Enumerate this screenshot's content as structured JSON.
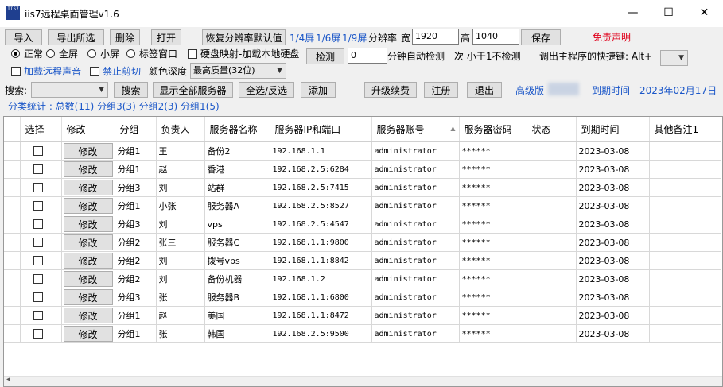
{
  "window": {
    "title": "iis7远程桌面管理v1.6",
    "icon_text": "IIS7",
    "minimize_glyph": "—",
    "maximize_glyph": "☐",
    "close_glyph": "✕"
  },
  "toolbar": {
    "import_label": "导入",
    "export_selected_label": "导出所选",
    "delete_label": "删除",
    "open_label": "打开",
    "restore_resolution_label": "恢复分辨率默认值",
    "screen_quarter": "1/4屏",
    "screen_sixth": "1/6屏",
    "screen_ninth": "1/9屏",
    "resolution_label": "分辨率",
    "width_label": "宽",
    "width_value": "1920",
    "height_label": "高",
    "height_value": "1040",
    "save_label": "保存",
    "disclaimer_label": "免责声明"
  },
  "options": {
    "mode_normal": "正常",
    "mode_fullscreen": "全屏",
    "mode_small": "小屏",
    "mode_tab": "标签窗口",
    "disk_map_label": "硬盘映射-加载本地硬盘",
    "detect_label": "检测",
    "detect_value": "0",
    "detect_suffix": "分钟自动检测一次 小于1不检测",
    "hotkey_label": "调出主程序的快捷键: Alt+",
    "load_sound_label": "加载远程声音",
    "disable_clipboard_label": "禁止剪切",
    "color_depth_label": "颜色深度",
    "color_depth_value": "最高质量(32位)"
  },
  "search": {
    "label": "搜索:",
    "search_button": "搜索",
    "show_all_button": "显示全部服务器",
    "select_all_button": "全选/反选",
    "add_button": "添加",
    "upgrade_button": "升级续费",
    "register_button": "注册",
    "exit_button": "退出",
    "edition_label": "高级版-",
    "expire_label": "到期时间",
    "expire_date": "2023年02月17日"
  },
  "stats": {
    "text": "分类统计 : 总数(11) 分组3(3) 分组2(3) 分组1(5)"
  },
  "table": {
    "headers": [
      "选择",
      "修改",
      "分组",
      "负责人",
      "服务器名称",
      "服务器IP和端口",
      "服务器账号",
      "服务器密码",
      "状态",
      "到期时间",
      "其他备注1"
    ],
    "edit_label": "修改",
    "rows": [
      {
        "group": "分组1",
        "owner": "王",
        "name": "备份2",
        "ip": "192.168.1.1",
        "account": "administrator",
        "password": "******",
        "status": "",
        "expire": "2023-03-08",
        "note": ""
      },
      {
        "group": "分组1",
        "owner": "赵",
        "name": "香港",
        "ip": "192.168.2.5:6284",
        "account": "administrator",
        "password": "******",
        "status": "",
        "expire": "2023-03-08",
        "note": ""
      },
      {
        "group": "分组3",
        "owner": "刘",
        "name": "站群",
        "ip": "192.168.2.5:7415",
        "account": "administrator",
        "password": "******",
        "status": "",
        "expire": "2023-03-08",
        "note": ""
      },
      {
        "group": "分组1",
        "owner": "小张",
        "name": "服务器A",
        "ip": "192.168.2.5:8527",
        "account": "administrator",
        "password": "******",
        "status": "",
        "expire": "2023-03-08",
        "note": ""
      },
      {
        "group": "分组3",
        "owner": "刘",
        "name": "vps",
        "ip": "192.168.2.5:4547",
        "account": "administrator",
        "password": "******",
        "status": "",
        "expire": "2023-03-08",
        "note": ""
      },
      {
        "group": "分组2",
        "owner": "张三",
        "name": "服务器C",
        "ip": "192.168.1.1:9800",
        "account": "administrator",
        "password": "******",
        "status": "",
        "expire": "2023-03-08",
        "note": ""
      },
      {
        "group": "分组2",
        "owner": "刘",
        "name": "拨号vps",
        "ip": "192.168.1.1:8842",
        "account": "administrator",
        "password": "******",
        "status": "",
        "expire": "2023-03-08",
        "note": ""
      },
      {
        "group": "分组2",
        "owner": "刘",
        "name": "备份机器",
        "ip": "192.168.1.2",
        "account": "administrator",
        "password": "******",
        "status": "",
        "expire": "2023-03-08",
        "note": ""
      },
      {
        "group": "分组3",
        "owner": "张",
        "name": "服务器B",
        "ip": "192.168.1.1:6800",
        "account": "administrator",
        "password": "******",
        "status": "",
        "expire": "2023-03-08",
        "note": ""
      },
      {
        "group": "分组1",
        "owner": "赵",
        "name": "美国",
        "ip": "192.168.1.1:8472",
        "account": "administrator",
        "password": "******",
        "status": "",
        "expire": "2023-03-08",
        "note": ""
      },
      {
        "group": "分组1",
        "owner": "张",
        "name": "韩国",
        "ip": "192.168.2.5:9500",
        "account": "administrator",
        "password": "******",
        "status": "",
        "expire": "2023-03-08",
        "note": ""
      }
    ]
  },
  "scrollbar": {
    "left_arrow": "◂"
  }
}
